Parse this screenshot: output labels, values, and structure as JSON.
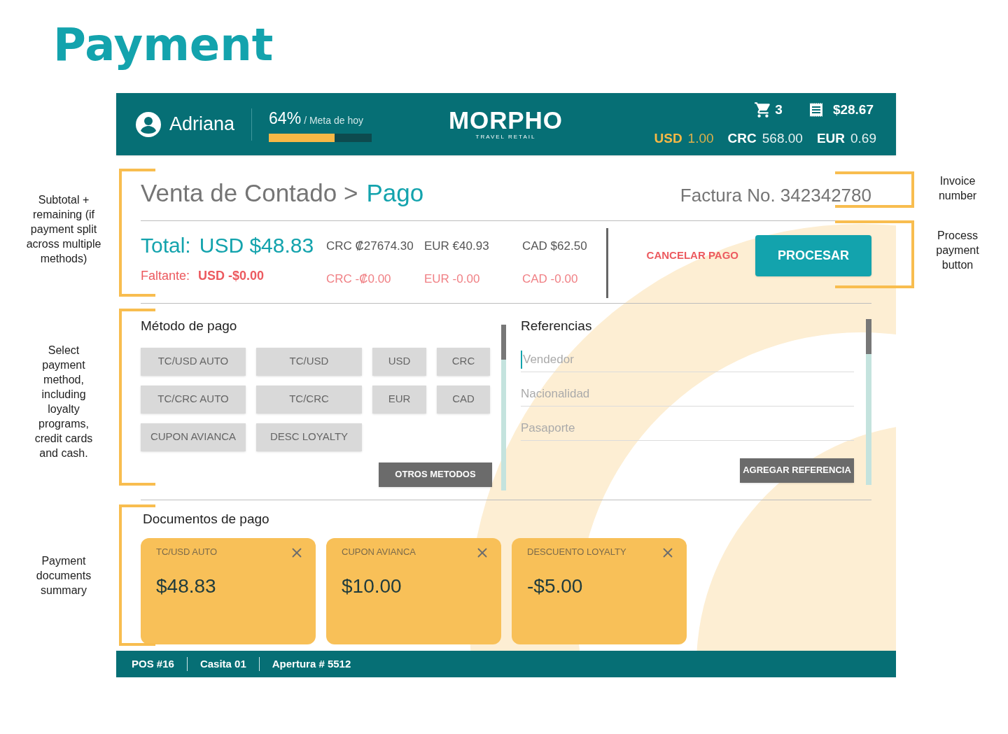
{
  "page_title": "Payment",
  "header": {
    "user": "Adriana",
    "goal_percent": "64%",
    "goal_label": "/ Meta de hoy",
    "goal": {
      "level": 0.64
    },
    "logo": "MORPHO",
    "logo_tagline": "TRAVEL RETAIL",
    "cart_count": "3",
    "ticket_total": "$28.67",
    "rates": [
      {
        "code": "USD",
        "value": "1.00",
        "selected": true
      },
      {
        "code": "CRC",
        "value": "568.00",
        "selected": false
      },
      {
        "code": "EUR",
        "value": "0.69",
        "selected": false
      }
    ]
  },
  "summary": {
    "breadcrumb": "Venta de Contado >",
    "current": "Pago",
    "invoice": "Factura No. 342342780",
    "total_label": "Total:",
    "total_value": "USD $48.83",
    "remaining_label": "Faltante:",
    "remaining_value": "USD -$0.00",
    "conversions": [
      {
        "total": "CRC ₡27674.30",
        "remaining": "CRC -₡0.00"
      },
      {
        "total": "EUR €40.93",
        "remaining": "EUR -0.00"
      },
      {
        "total": "CAD $62.50",
        "remaining": "CAD -0.00"
      }
    ],
    "cancel": "CANCELAR PAGO",
    "process": "PROCESAR"
  },
  "methods": {
    "title": "Método de pago",
    "rows": [
      [
        "TC/USD AUTO",
        "TC/USD",
        "USD",
        "CRC"
      ],
      [
        "TC/CRC AUTO",
        "TC/CRC",
        "EUR",
        "CAD"
      ],
      [
        "CUPON AVIANCA",
        "DESC LOYALTY"
      ]
    ],
    "other": "OTROS METODOS"
  },
  "references": {
    "title": "Referencias",
    "fields": [
      {
        "placeholder": "Vendedor",
        "focused": true
      },
      {
        "placeholder": "Nacionalidad",
        "focused": false
      },
      {
        "placeholder": "Pasaporte",
        "focused": false
      }
    ],
    "add": "AGREGAR REFERENCIA"
  },
  "documents": {
    "title": "Documentos de pago",
    "items": [
      {
        "label": "TC/USD AUTO",
        "amount": "$48.83"
      },
      {
        "label": "CUPON AVIANCA",
        "amount": "$10.00"
      },
      {
        "label": "DESCUENTO LOYALTY",
        "amount": "-$5.00"
      }
    ]
  },
  "status_bar": [
    "POS #16",
    "Casita 01",
    "Apertura # 5512"
  ],
  "annotations": {
    "summary": "Subtotal + remaining (if payment split across multiple methods)",
    "methods": "Select payment method, including loyalty programs, credit cards and cash.",
    "documents": "Payment documents summary",
    "invoice": "Invoice number",
    "process": "Process payment button"
  }
}
